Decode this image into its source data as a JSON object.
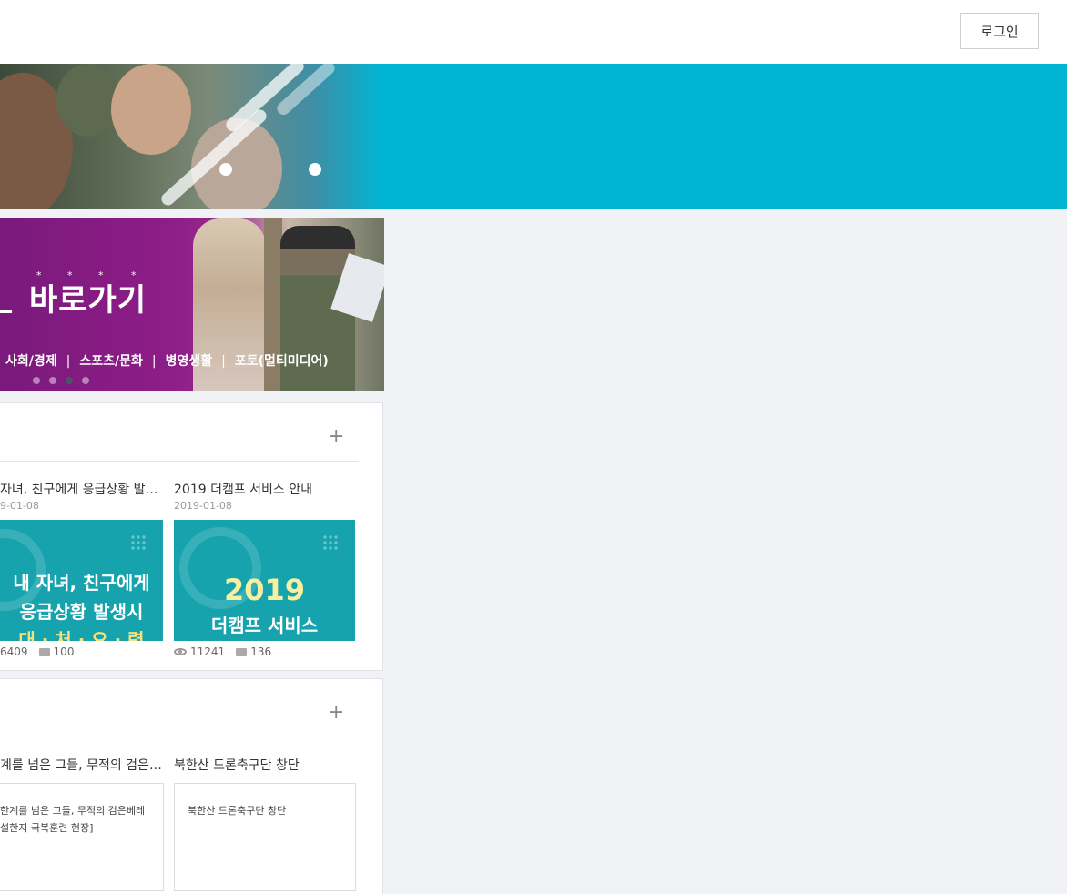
{
  "header": {
    "login_label": "로그인"
  },
  "banner": {
    "title": "바로가기",
    "title_prefix": "",
    "menu": [
      "사회/경제",
      "스포츠/문화",
      "병영생활",
      "포토(멀티미디어)"
    ],
    "slide_count": 4,
    "active_slide": 3
  },
  "card1": {
    "items": [
      {
        "title": "자녀, 친구에게 응급상황 발…",
        "date": "9-01-08",
        "thumb_lines": [
          "내 자녀, 친구에게",
          "응급상황 발생시",
          "대 · 처 · 요 · 령"
        ],
        "views": "6409",
        "comments": "100"
      },
      {
        "title": "2019 더캠프 서비스 안내",
        "date": "2019-01-08",
        "thumb_lines": [
          "2019",
          "더캠프 서비스"
        ],
        "views": "11241",
        "comments": "136"
      }
    ]
  },
  "card2": {
    "items": [
      {
        "title": "계를 넘은 그들, 무적의 검은…",
        "body": [
          "한계를 넘은 그들, 무적의 검은베레",
          "설한지 극복훈련 현장]"
        ]
      },
      {
        "title": "북한산 드론축구단 창단",
        "body": [
          "북한산 드론축구단 창단"
        ]
      }
    ]
  },
  "colors": {
    "hero_bg": "#00b5d3",
    "banner_purple": "#8e1d88",
    "thumb_teal": "#16a3ad",
    "page_bg": "#f1f2f6"
  }
}
